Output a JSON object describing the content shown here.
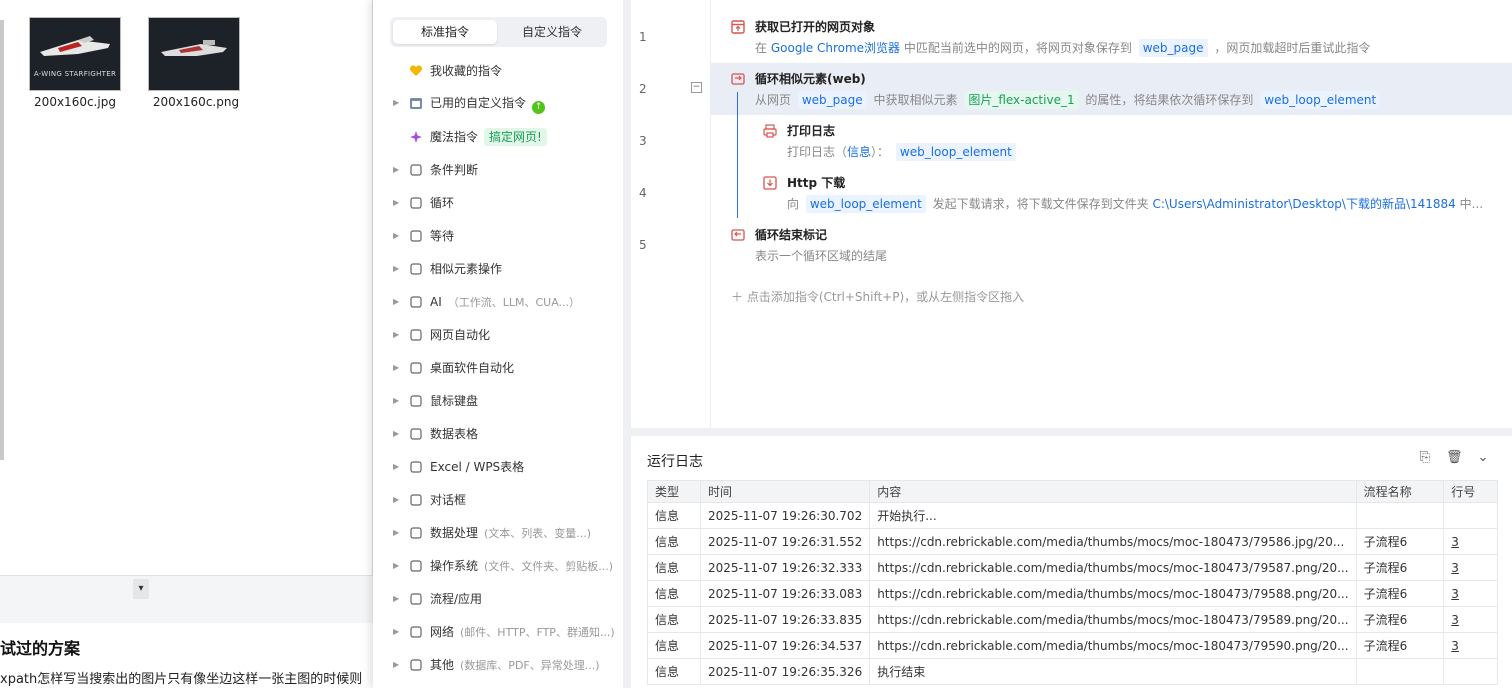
{
  "files": [
    {
      "name": "200x160c.jpg",
      "caption": "A-WING STARFIGHTER"
    },
    {
      "name": "200x160c.png",
      "caption": ""
    }
  ],
  "left_article": {
    "heading": "试过的方案",
    "text": "xpath怎样写当搜索出的图片只有像坐边这样一张主图的时候则"
  },
  "command_panel": {
    "tabs": [
      {
        "label": "标准指令"
      },
      {
        "label": "自定义指令"
      }
    ],
    "favorites": "我收藏的指令",
    "used_custom": "已用的自定义指令",
    "used_custom_badge": "↑",
    "magic": "魔法指令",
    "magic_badge": "搞定网页!",
    "items": [
      {
        "label": "条件判断",
        "hint": ""
      },
      {
        "label": "循环",
        "hint": ""
      },
      {
        "label": "等待",
        "hint": ""
      },
      {
        "label": "相似元素操作",
        "hint": ""
      },
      {
        "label": "AI",
        "hint": "（工作流、LLM、CUA...）"
      },
      {
        "label": "网页自动化",
        "hint": ""
      },
      {
        "label": "桌面软件自动化",
        "hint": ""
      },
      {
        "label": "鼠标键盘",
        "hint": ""
      },
      {
        "label": "数据表格",
        "hint": ""
      },
      {
        "label": "Excel / WPS表格",
        "hint": ""
      },
      {
        "label": "对话框",
        "hint": ""
      },
      {
        "label": "数据处理",
        "hint": "(文本、列表、变量...)"
      },
      {
        "label": "操作系统",
        "hint": "(文件、文件夹、剪贴板...)"
      },
      {
        "label": "流程/应用",
        "hint": ""
      },
      {
        "label": "网络",
        "hint": "(邮件、HTTP、FTP、群通知...)"
      },
      {
        "label": "其他",
        "hint": "(数据库、PDF、异常处理...)"
      }
    ]
  },
  "editor": {
    "line_numbers": [
      "1",
      "2",
      "3",
      "4",
      "5"
    ],
    "fold_symbol": "−",
    "steps": [
      {
        "title": "获取已打开的网页对象",
        "desc_prefix": "在",
        "desc_link": "Google Chrome浏览器",
        "desc_mid": "中匹配当前选中的网页，将网页对象保存到",
        "desc_var": "web_page",
        "desc_suffix": "，网页加载超时后重试此指令"
      },
      {
        "title": "循环相似元素(web)",
        "desc_prefix": "从网页",
        "desc_var1": "web_page",
        "desc_mid": "中获取相似元素",
        "desc_elem": "图片_flex-active_1",
        "desc_mid2": "的属性，将结果依次循环保存到",
        "desc_var2": "web_loop_element"
      },
      {
        "title": "打印日志",
        "desc_prefix": "打印日志（",
        "desc_level": "信息",
        "desc_mid": "）：",
        "desc_var": "web_loop_element"
      },
      {
        "title": "Http 下载",
        "desc_prefix": "向",
        "desc_var": "web_loop_element",
        "desc_mid": "发起下载请求，将下载文件保存到文件夹",
        "desc_link": "C:\\Users\\Administrator\\Desktop\\下载的新品\\141884",
        "desc_suffix": "中..."
      },
      {
        "title": "循环结束标记",
        "desc_prefix": "表示一个循环区域的结尾"
      }
    ],
    "add_hint": "＋  点击添加指令(Ctrl+Shift+P)，或从左侧指令区拖入"
  },
  "log": {
    "title": "运行日志",
    "columns": [
      "类型",
      "时间",
      "内容",
      "流程名称",
      "行号"
    ],
    "rows": [
      {
        "type": "信息",
        "time": "2025-11-07 19:26:30.702",
        "content": "开始执行...",
        "flow": "",
        "line": ""
      },
      {
        "type": "信息",
        "time": "2025-11-07 19:26:31.552",
        "content": "https://cdn.rebrickable.com/media/thumbs/mocs/moc-180473/79586.jpg/20...",
        "flow": "子流程6",
        "line": "3"
      },
      {
        "type": "信息",
        "time": "2025-11-07 19:26:32.333",
        "content": "https://cdn.rebrickable.com/media/thumbs/mocs/moc-180473/79587.png/20...",
        "flow": "子流程6",
        "line": "3"
      },
      {
        "type": "信息",
        "time": "2025-11-07 19:26:33.083",
        "content": "https://cdn.rebrickable.com/media/thumbs/mocs/moc-180473/79588.png/20...",
        "flow": "子流程6",
        "line": "3"
      },
      {
        "type": "信息",
        "time": "2025-11-07 19:26:33.835",
        "content": "https://cdn.rebrickable.com/media/thumbs/mocs/moc-180473/79589.png/20...",
        "flow": "子流程6",
        "line": "3"
      },
      {
        "type": "信息",
        "time": "2025-11-07 19:26:34.537",
        "content": "https://cdn.rebrickable.com/media/thumbs/mocs/moc-180473/79590.png/20...",
        "flow": "子流程6",
        "line": "3"
      },
      {
        "type": "信息",
        "time": "2025-11-07 19:26:35.326",
        "content": "执行结束",
        "flow": "",
        "line": ""
      }
    ]
  },
  "colors": {
    "accent": "#1a6fe0",
    "green": "#18a058",
    "highlight_row": "#e9edf5"
  }
}
